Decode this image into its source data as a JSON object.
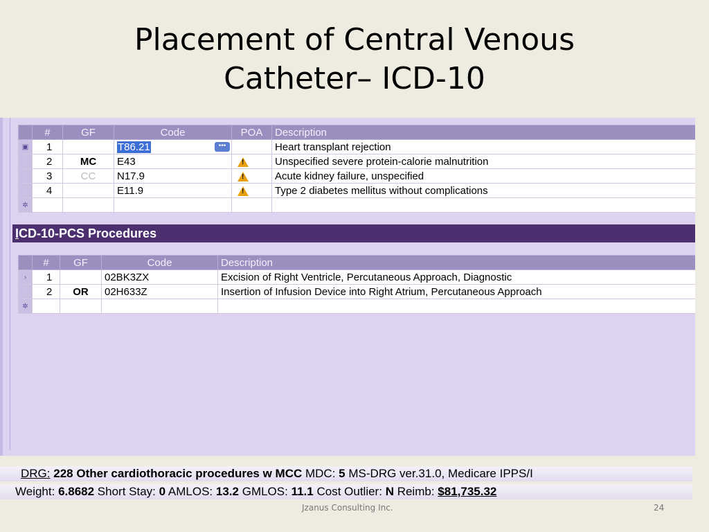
{
  "slide": {
    "title_line1": "Placement of Central Venous",
    "title_line2": "Catheter– ICD-10",
    "footer_company": "Jzanus Consulting Inc.",
    "page_number": "24"
  },
  "diagnoses": {
    "headers": [
      "#",
      "GF",
      "Code",
      "POA",
      "Description"
    ],
    "rows": [
      {
        "num": "1",
        "gf": "",
        "code": "T86.21",
        "poa_icon": "",
        "description": "Heart transplant rejection"
      },
      {
        "num": "2",
        "gf": "MC",
        "code": "E43",
        "poa_icon": "warning-icon",
        "description": "Unspecified severe protein-calorie malnutrition"
      },
      {
        "num": "3",
        "gf": "CC",
        "code": "N17.9",
        "poa_icon": "warning-icon",
        "description": "Acute kidney failure, unspecified"
      },
      {
        "num": "4",
        "gf": "",
        "code": "E11.9",
        "poa_icon": "warning-icon",
        "description": "Type 2 diabetes mellitus without complications"
      }
    ]
  },
  "procedures": {
    "section_title_first": "I",
    "section_title_rest": "CD-10-PCS Procedures",
    "headers": [
      "#",
      "GF",
      "Code",
      "Description"
    ],
    "rows": [
      {
        "num": "1",
        "gf": "",
        "code": "02BK3ZX",
        "description": "Excision of Right Ventricle, Percutaneous Approach, Diagnostic"
      },
      {
        "num": "2",
        "gf": "OR",
        "code": "02H633Z",
        "description": "Insertion of Infusion Device into Right Atrium, Percutaneous Approach"
      }
    ]
  },
  "drg": {
    "label": "DRG:",
    "number": "228",
    "description": "Other cardiothoracic procedures w MCC",
    "mdc_label": "MDC:",
    "mdc_value": "5",
    "version_text": "MS-DRG ver.31.0, Medicare IPPS/I"
  },
  "stats": {
    "weight_label": "Weight:",
    "weight_value": "6.8682",
    "short_stay_label": "Short Stay:",
    "short_stay_value": "0",
    "amlos_label": "AMLOS:",
    "amlos_value": "13.2",
    "gmlos_label": "GMLOS:",
    "gmlos_value": "11.1",
    "cost_outlier_label": "Cost Outlier:",
    "cost_outlier_value": "N",
    "reimb_label": "Reimb:",
    "reimb_value": "$81,735.32"
  },
  "colors": {
    "panel_bg": "#ddd3f1",
    "header_bg": "#9b8fc0",
    "section_bar_bg": "#4b2f6f",
    "warning": "#e8a010"
  }
}
